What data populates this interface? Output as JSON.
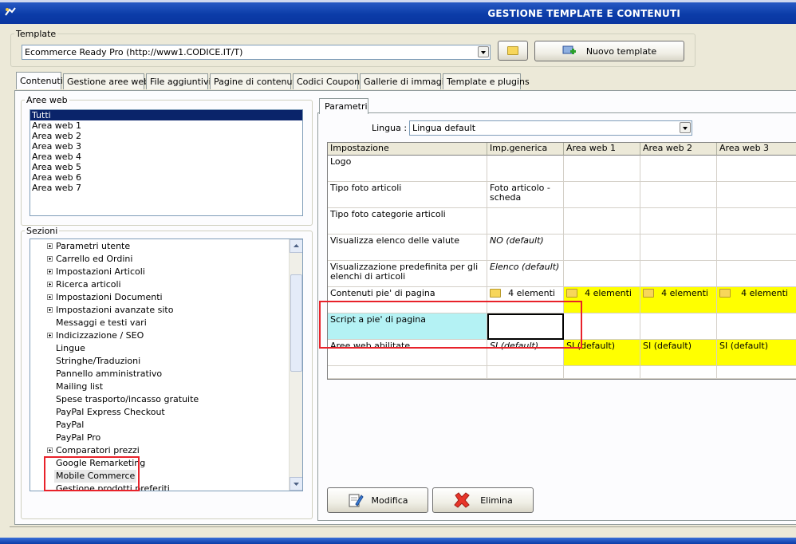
{
  "window": {
    "title": "GESTIONE TEMPLATE E CONTENUTI"
  },
  "template": {
    "label": "Template",
    "selected": "Ecommerce Ready Pro (http://www1.CODICE.IT/T)",
    "new_button": "Nuovo template"
  },
  "tabs": [
    "Contenuti",
    "Gestione aree web",
    "File aggiuntivi",
    "Pagine di contenuti",
    "Codici Coupon",
    "Gallerie di immagini",
    "Template e plugins"
  ],
  "aree_web": {
    "label": "Aree web",
    "items": [
      "Tutti",
      "Area web 1",
      "Area web 2",
      "Area web 3",
      "Area web 4",
      "Area web 5",
      "Area web 6",
      "Area web 7"
    ]
  },
  "sezioni": {
    "label": "Sezioni",
    "items": [
      "Parametri utente",
      "Carrello ed Ordini",
      "Impostazioni Articoli",
      "Ricerca articoli",
      "Impostazioni Documenti",
      "Impostazioni avanzate sito",
      "Messaggi e testi vari",
      "Indicizzazione / SEO",
      "Lingue",
      "Stringhe/Traduzioni",
      "Pannello amministrativo",
      "Mailing list",
      "Spese trasporto/incasso gratuite",
      "PayPal Express Checkout",
      "PayPal",
      "PayPal Pro",
      "Comparatori prezzi",
      "Google Remarketing",
      "Mobile Commerce",
      "Gestione prodotti preferiti"
    ]
  },
  "parametri": {
    "tab": "Parametri",
    "lingua_label": "Lingua :",
    "lingua_value": "Lingua default",
    "headers": [
      "Impostazione",
      "Imp.generica",
      "Area web 1",
      "Area web 2",
      "Area web 3"
    ],
    "rows": [
      {
        "label": "Logo",
        "generic": "",
        "a1": "",
        "a2": "",
        "a3": ""
      },
      {
        "label": "Tipo foto articoli",
        "generic": "Foto articolo - scheda",
        "a1": "",
        "a2": "",
        "a3": ""
      },
      {
        "label": "Tipo foto categorie articoli",
        "generic": "",
        "a1": "",
        "a2": "",
        "a3": ""
      },
      {
        "label": "Visualizza elenco delle valute",
        "generic": "NO (default)",
        "a1": "",
        "a2": "",
        "a3": ""
      },
      {
        "label": "Visualizzazione predefinita per gli elenchi di articoli",
        "generic": "Elenco (default)",
        "a1": "",
        "a2": "",
        "a3": ""
      },
      {
        "label": "Contenuti pie' di pagina",
        "generic": "4 elementi",
        "a1": "4 elementi",
        "a2": "4 elementi",
        "a3": "4 elementi"
      },
      {
        "label": "Script a pie' di pagina",
        "generic": "",
        "a1": "",
        "a2": "",
        "a3": ""
      },
      {
        "label": "Aree web abilitate",
        "generic": "SI (default)",
        "a1": "SI (default)",
        "a2": "SI (default)",
        "a3": "SI (default)"
      }
    ]
  },
  "actions": {
    "modifica": "Modifica",
    "elimina": "Elimina"
  },
  "colors": {
    "titlebar": "#0b3ca8",
    "highlight_yellow": "#ffff00",
    "selected_cell": "#b4f2f4",
    "annotation_red": "#e8222a"
  }
}
